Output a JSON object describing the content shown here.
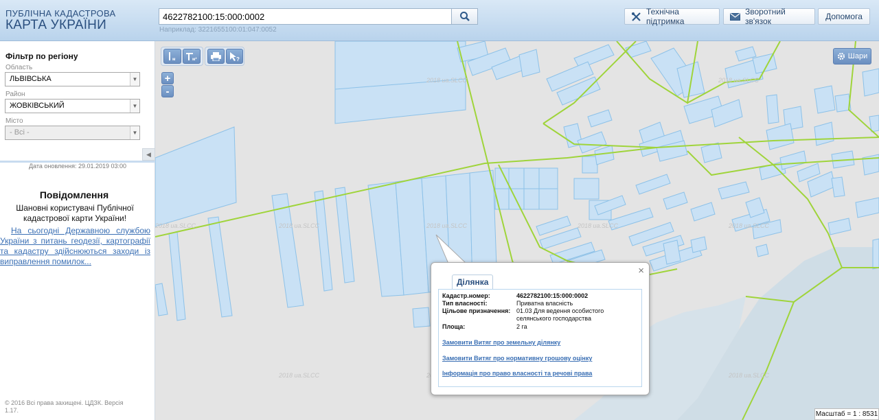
{
  "header": {
    "logo_line1": "ПУБЛІЧНА КАДАСТРОВА",
    "logo_line2": "КАРТА УКРАЇНИ",
    "search_value": "4622782100:15:000:0002",
    "search_hint": "Наприклад: 3221655100:01:047:0052",
    "support_label": "Технічна підтримка",
    "feedback_label": "Зворотний зв'язок",
    "help_label": "Допомога"
  },
  "sidebar": {
    "filter_title": "Фільтр по регіону",
    "oblast_label": "Область",
    "oblast_value": "ЛЬВІВСЬКА",
    "rayon_label": "Район",
    "rayon_value": "ЖОВКІВСЬКИЙ",
    "city_label": "Місто",
    "city_value": "- Всі -",
    "update_text": "Дата оновлення: 29.01.2019 03:00",
    "message_title": "Повідомлення",
    "message_body": "Шановні користувачі Публічної кадастрової карти України!",
    "message_link": "На сьогодні Державною службою України з питань геодезії, картографії та кадастру здійснюються заходи із виправлення помилок...",
    "copyright": "© 2016 Всі права захищені. ЦДЗК. Версія 1.17."
  },
  "map": {
    "layers_label": "Шари",
    "watermark": "2018 ua.SLCC",
    "scale_text": "Масштаб = 1 : 8531",
    "zoom_in": "+",
    "zoom_out": "-"
  },
  "popup": {
    "tab_label": "Ділянка",
    "close": "×",
    "cad_key": "Кадастр.номер:",
    "cad_value": "4622782100:15:000:0002",
    "own_key": "Тип власності:",
    "own_value": "Приватна власність",
    "purpose_key": "Цільове призначення:",
    "purpose_value": "01.03 Для ведення особистого селянського господарства",
    "area_key": "Площа:",
    "area_value": "2 га",
    "link1": "Замовити Витяг про земельну ділянку",
    "link2": "Замовити Витяг про нормативну грошову оцінку",
    "link3": "Інформація про право власності та речові права"
  },
  "colors": {
    "parcel_fill": "#c9e1f5",
    "parcel_stroke": "#8cc1e8",
    "boundary": "#9fd43a",
    "water": "#cfdde6"
  }
}
